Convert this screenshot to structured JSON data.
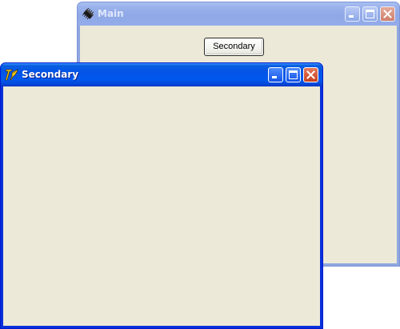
{
  "windows": {
    "main": {
      "title": "Main",
      "icon": "chip-icon",
      "active": false,
      "controls": [
        "minimize",
        "maximize",
        "close"
      ],
      "secondary_button_label": "Secondary"
    },
    "secondary": {
      "title": "Secondary",
      "icon": "tcl-feather-icon",
      "active": true,
      "controls": [
        "minimize",
        "maximize",
        "close"
      ]
    }
  },
  "colors": {
    "active_titlebar": "#0454e5",
    "inactive_titlebar": "#8fa8e6",
    "client_background": "#ece9d8",
    "close_button_active": "#c8401e"
  }
}
